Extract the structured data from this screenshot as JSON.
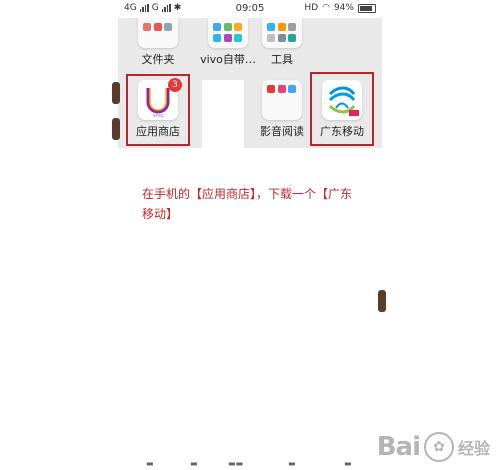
{
  "status_bar": {
    "network": "4G",
    "network2": "G",
    "time": "09:05",
    "hd": "HD",
    "battery": "94%"
  },
  "home": {
    "apps_top": [
      {
        "label": "文件夹"
      },
      {
        "label": "vivo自带…"
      },
      {
        "label": "工具"
      }
    ],
    "apps_row2": [
      {
        "label": "应用商店",
        "badge": "3"
      },
      {
        "label": "影音阅读"
      },
      {
        "label": "广东移动"
      }
    ],
    "colors": {
      "highlight": "#b5272d",
      "badge": "#e53935"
    }
  },
  "instruction": {
    "text": "在手机的【应用商店】，下载一个【广东移动】",
    "color": "#c62828"
  },
  "watermark": {
    "main": "Bai",
    "sub": "经验"
  }
}
